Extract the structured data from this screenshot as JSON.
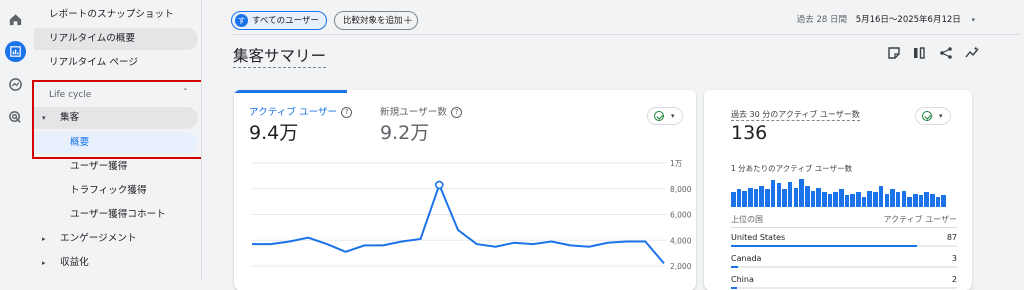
{
  "rail": {
    "icons": [
      "home-icon",
      "reports-icon",
      "explore-icon",
      "advertising-icon"
    ]
  },
  "sidebar": {
    "items": [
      {
        "label": "レポートのスナップショット",
        "type": "top-plain"
      },
      {
        "label": "リアルタイムの概要",
        "type": "top-plain"
      },
      {
        "label": "リアルタイム ページ",
        "type": "top-plain"
      }
    ],
    "section": {
      "label": "Life cycle"
    },
    "lifecycle": [
      {
        "label": "集客",
        "caret": "▾"
      },
      {
        "label": "概要"
      },
      {
        "label": "ユーザー獲得"
      },
      {
        "label": "トラフィック獲得"
      },
      {
        "label": "ユーザー獲得コホート"
      },
      {
        "label": "エンゲージメント",
        "caret": "▸"
      },
      {
        "label": "収益化",
        "caret": "▸"
      }
    ]
  },
  "header": {
    "segment_avatar": "す",
    "segment_label": "すべてのユーザー",
    "add_compare_label": "比較対象を追加",
    "add_compare_icon": "＋",
    "date_prefix": "過去 28 日間",
    "date_range": "5月16日～2025年6月12日",
    "date_caret": "▾"
  },
  "page": {
    "title": "集客サマリー"
  },
  "metrics": {
    "active_users": {
      "label": "アクティブ ユーザー",
      "value": "9.4万"
    },
    "new_users": {
      "label": "新規ユーザー数",
      "value": "9.2万"
    },
    "help_icon": "?"
  },
  "realtime": {
    "title": "過去 30 分のアクティブ ユーザー数",
    "value": "136",
    "per_minute_label": "1 分あたりのアクティブ ユーザー数",
    "table_header_left": "上位の国",
    "table_header_right": "アクティブ ユーザー",
    "countries": [
      {
        "name": "United States",
        "value": "87",
        "share": 1.0
      },
      {
        "name": "Canada",
        "value": "3",
        "share": 0.04
      },
      {
        "name": "China",
        "value": "2",
        "share": 0.03
      }
    ],
    "minute_bars": [
      10,
      12,
      11,
      13,
      12,
      14,
      12,
      18,
      16,
      12,
      17,
      13,
      19,
      14,
      11,
      13,
      10,
      9,
      10,
      12,
      8,
      9,
      10,
      7,
      11,
      10,
      14,
      9,
      12,
      10,
      11,
      7,
      9,
      8,
      10,
      9,
      7,
      8
    ],
    "accent": "#1a73e8"
  },
  "chart_data": {
    "type": "line",
    "yticks": [
      "1万",
      "8,000",
      "6,000",
      "4,000",
      "2,000"
    ],
    "ylim": [
      2000,
      10000
    ],
    "x": [
      1,
      2,
      3,
      4,
      5,
      6,
      7,
      8,
      9,
      10,
      11,
      12,
      13,
      14,
      15,
      16,
      17,
      18,
      19,
      20
    ],
    "series": [
      {
        "values": [
          3700,
          3700,
          3900,
          4200,
          3700,
          3100,
          3600,
          3600,
          3900,
          4100,
          8300,
          4800,
          3700,
          3500,
          3800,
          3700,
          3900,
          3600,
          3500,
          3800,
          3900,
          3900,
          2200
        ]
      }
    ],
    "color": "#1a73e8"
  }
}
